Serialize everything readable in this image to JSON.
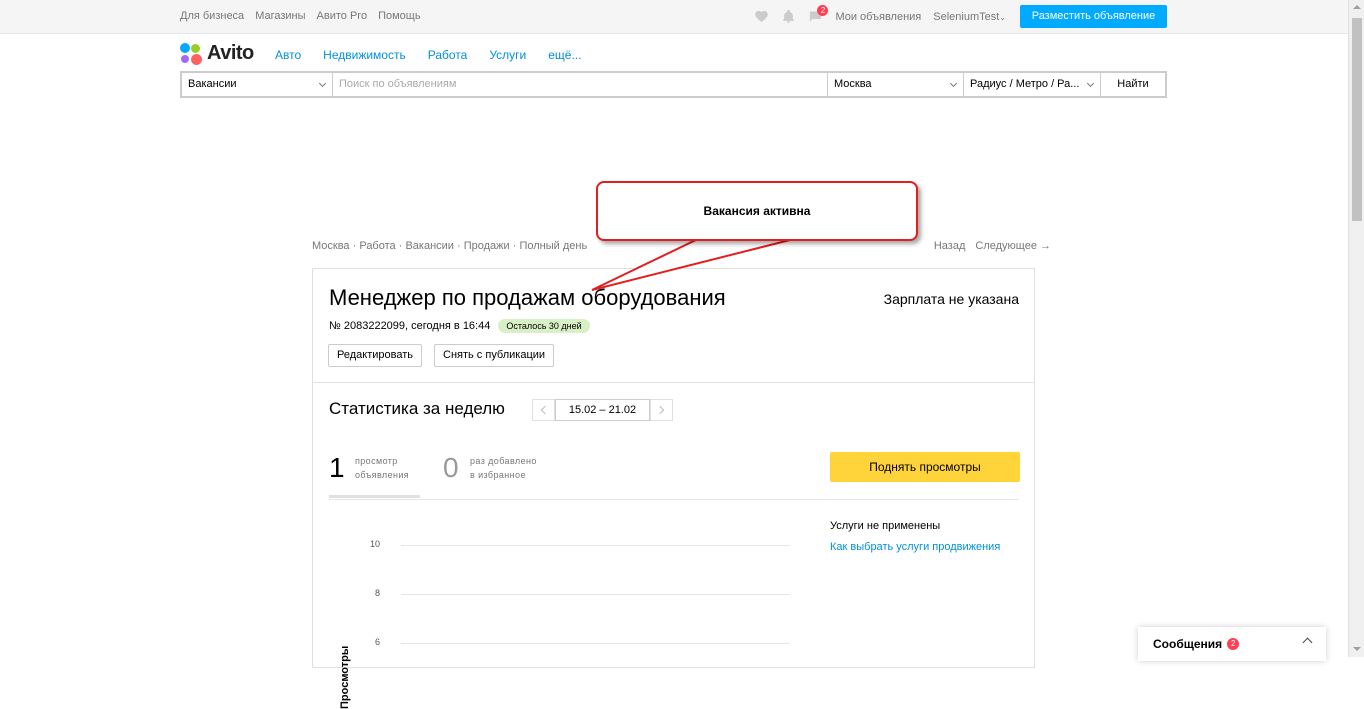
{
  "topbar": {
    "links": [
      "Для бизнеса",
      "Магазины",
      "Авито Pro",
      "Помощь"
    ],
    "messages_badge": "2",
    "my_ads": "Мои объявления",
    "user": "SeleniumTest",
    "post_button": "Разместить объявление"
  },
  "header": {
    "logo_text": "Avito",
    "nav": [
      "Авто",
      "Недвижимость",
      "Работа",
      "Услуги",
      "ещё..."
    ]
  },
  "search": {
    "category": "Вакансии",
    "query_placeholder": "Поиск по объявлениям",
    "city": "Москва",
    "radius": "Радиус / Метро / Ра...",
    "find_button": "Найти"
  },
  "callout": {
    "text": "Вакансия активна"
  },
  "breadcrumbs": {
    "items": [
      "Москва",
      "Работа",
      "Вакансии",
      "Продажи",
      "Полный день"
    ],
    "back": "Назад",
    "next": "Следующее →"
  },
  "ad": {
    "title": "Менеджер по продажам оборудования",
    "salary": "Зарплата не указана",
    "meta": "№ 2083222099, сегодня в 16:44",
    "remaining": "Осталось 30 дней",
    "edit_button": "Редактировать",
    "unpublish_button": "Снять с публикации"
  },
  "stats": {
    "title": "Статистика за неделю",
    "date_range": "15.02 – 21.02",
    "views": {
      "value": "1",
      "label_line1": "просмотр",
      "label_line2": "объявления"
    },
    "favorites": {
      "value": "0",
      "label_line1": "раз добавлено",
      "label_line2": "в избранное"
    },
    "raise_button": "Поднять просмотры",
    "services_none": "Услуги не применены",
    "services_link": "Как выбрать услуги продвижения",
    "y_axis_title": "Просмотры",
    "y_ticks": [
      "10",
      "8",
      "6"
    ]
  },
  "messages_widget": {
    "label": "Сообщения",
    "count": "2"
  },
  "colors": {
    "accent_blue": "#00aaff",
    "link_blue": "#0091d9",
    "raise_yellow": "#ffd43b",
    "remaining_green": "#d9f0c6",
    "badge_red": "#ff4053",
    "callout_red": "#e21f1f"
  }
}
